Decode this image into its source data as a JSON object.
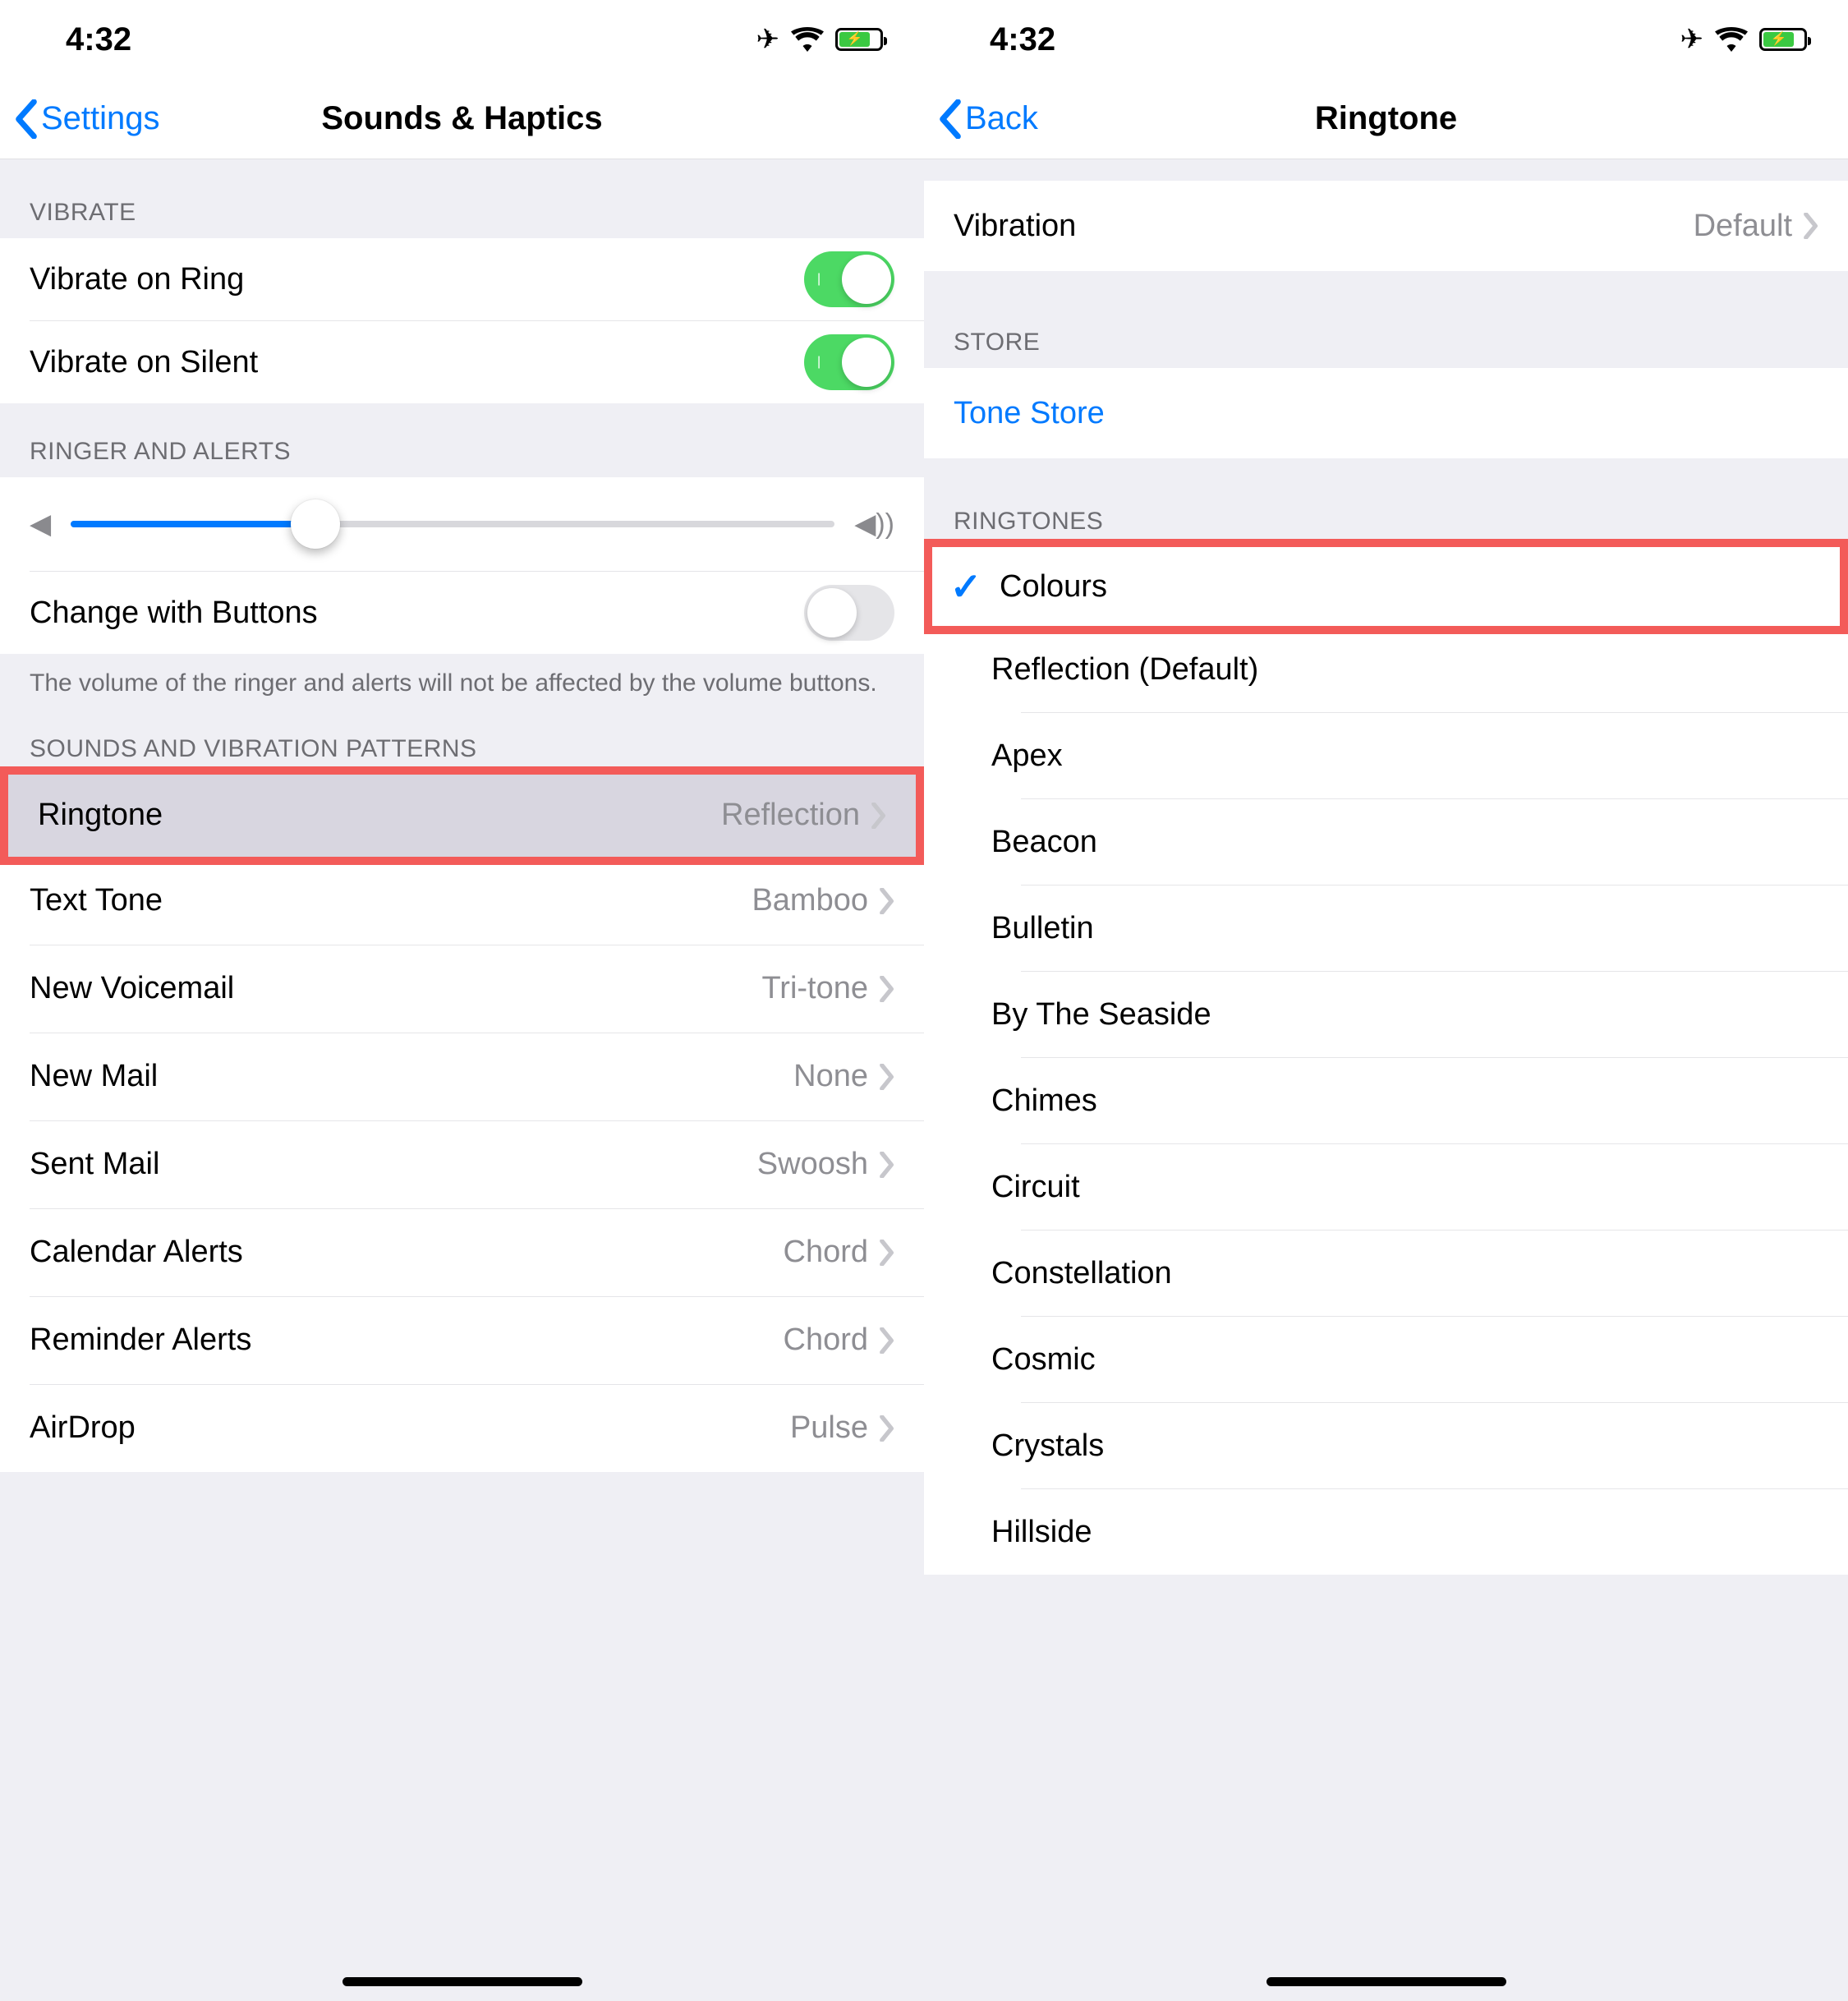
{
  "status": {
    "time": "4:32"
  },
  "screen1": {
    "back_label": "Settings",
    "title": "Sounds & Haptics",
    "sections": {
      "vibrate_header": "VIBRATE",
      "ringer_header": "RINGER AND ALERTS",
      "patterns_header": "SOUNDS AND VIBRATION PATTERNS",
      "volume_footer": "The volume of the ringer and alerts will not be affected by the volume buttons."
    },
    "vibrate_on_ring": "Vibrate on Ring",
    "vibrate_on_silent": "Vibrate on Silent",
    "change_with_buttons": "Change with Buttons",
    "patterns": [
      {
        "label": "Ringtone",
        "value": "Reflection",
        "highlight": true
      },
      {
        "label": "Text Tone",
        "value": "Bamboo"
      },
      {
        "label": "New Voicemail",
        "value": "Tri-tone"
      },
      {
        "label": "New Mail",
        "value": "None"
      },
      {
        "label": "Sent Mail",
        "value": "Swoosh"
      },
      {
        "label": "Calendar Alerts",
        "value": "Chord"
      },
      {
        "label": "Reminder Alerts",
        "value": "Chord"
      },
      {
        "label": "AirDrop",
        "value": "Pulse"
      }
    ]
  },
  "screen2": {
    "back_label": "Back",
    "title": "Ringtone",
    "vibration_label": "Vibration",
    "vibration_value": "Default",
    "store_header": "STORE",
    "tone_store": "Tone Store",
    "ringtones_header": "RINGTONES",
    "ringtones": [
      {
        "label": "Colours",
        "selected": true,
        "highlight": true
      },
      {
        "label": "Reflection (Default)"
      },
      {
        "label": "Apex"
      },
      {
        "label": "Beacon"
      },
      {
        "label": "Bulletin"
      },
      {
        "label": "By The Seaside"
      },
      {
        "label": "Chimes"
      },
      {
        "label": "Circuit"
      },
      {
        "label": "Constellation"
      },
      {
        "label": "Cosmic"
      },
      {
        "label": "Crystals"
      },
      {
        "label": "Hillside"
      }
    ]
  }
}
